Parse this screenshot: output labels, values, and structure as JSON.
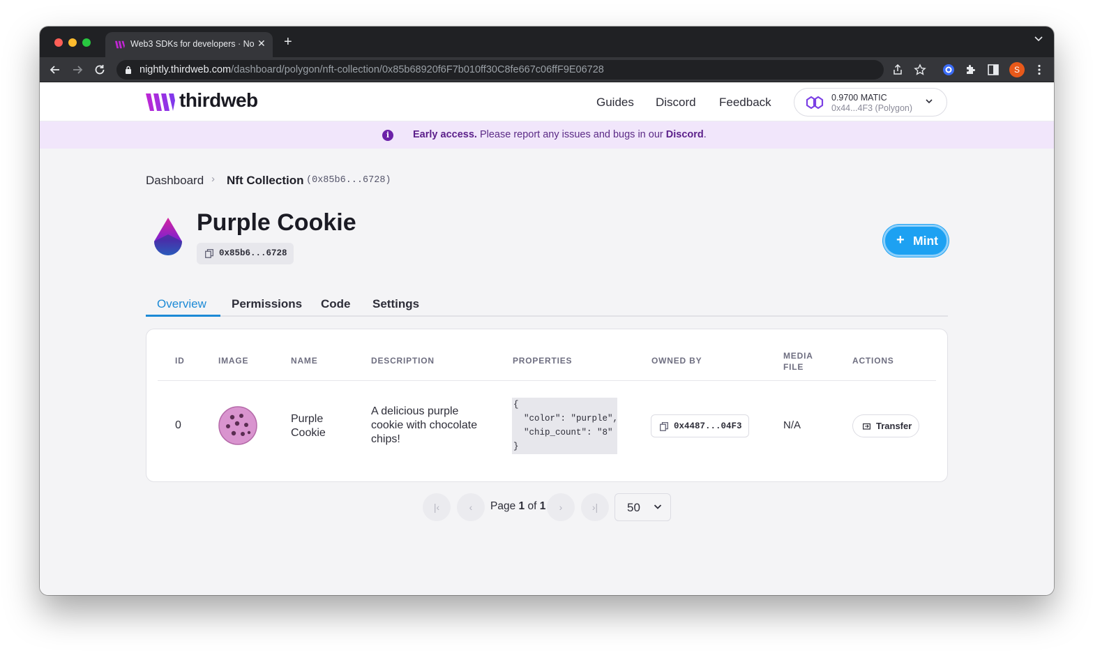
{
  "browser": {
    "tab_title": "Web3 SDKs for developers · No",
    "new_tab": "+",
    "url_host": "nightly.thirdweb.com",
    "url_path": "/dashboard/polygon/nft-collection/0x85b68920f6F7b010ff30C8fe667c06ffF9E06728",
    "profile_initial": "S"
  },
  "header": {
    "logo_text": "thirdweb",
    "nav": [
      "Guides",
      "Discord",
      "Feedback"
    ],
    "wallet_balance": "0.9700 MATIC",
    "wallet_address": "0x44...4F3 (Polygon)"
  },
  "banner": {
    "strong": "Early access.",
    "text": " Please report any issues and bugs in our ",
    "link": "Discord",
    "end": "."
  },
  "breadcrumb": {
    "root": "Dashboard",
    "separator": "›",
    "current": "Nft Collection",
    "address": "(0x85b6...6728)"
  },
  "contract": {
    "title": "Purple Cookie",
    "address": "0x85b6...6728",
    "mint_label": "Mint"
  },
  "tabs": [
    "Overview",
    "Permissions",
    "Code",
    "Settings"
  ],
  "table": {
    "headers": [
      "ID",
      "IMAGE",
      "NAME",
      "DESCRIPTION",
      "PROPERTIES",
      "OWNED BY",
      "MEDIA FILE",
      "ACTIONS"
    ],
    "rows": [
      {
        "id": "0",
        "name": "Purple Cookie",
        "description": "A delicious purple cookie with chocolate chips!",
        "properties": "{\n  \"color\": \"purple\",\n  \"chip_count\": \"8\"\n}",
        "owner": "0x4487...04F3",
        "media": "N/A",
        "action": "Transfer"
      }
    ]
  },
  "pagination": {
    "page_label": "Page",
    "current": "1",
    "of": "of",
    "total": "1",
    "page_size": "50"
  },
  "colors": {
    "accent": "#1da1f2",
    "brand_purple": "#6b21a8",
    "banner_bg": "#f1e6fb"
  }
}
